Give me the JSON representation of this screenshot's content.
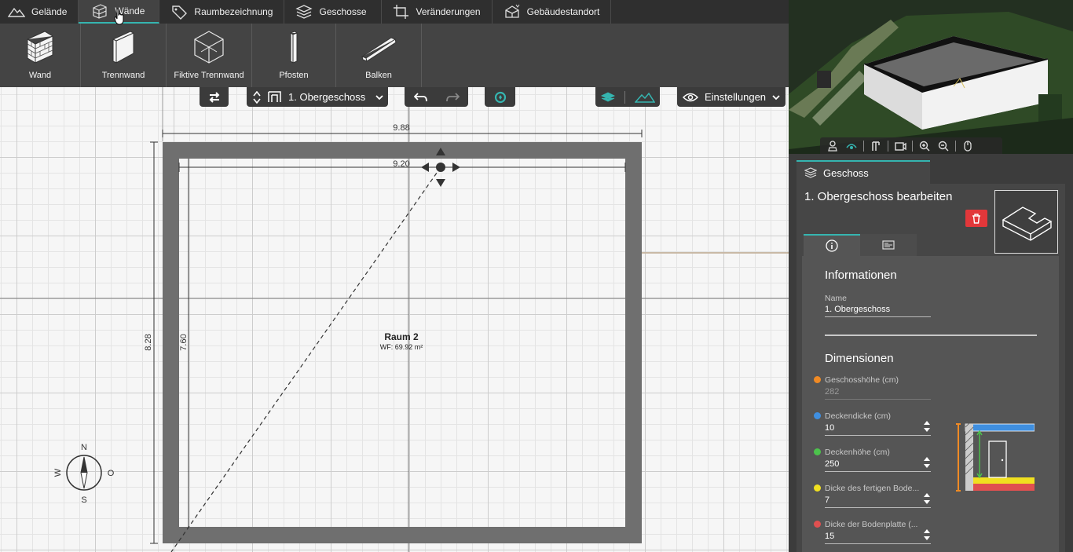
{
  "top_tabs": [
    {
      "label": "Gelände",
      "icon": "terrain-icon"
    },
    {
      "label": "Wände",
      "icon": "wall-icon"
    },
    {
      "label": "Raumbezeichnung",
      "icon": "tag-icon"
    },
    {
      "label": "Geschosse",
      "icon": "layers-icon"
    },
    {
      "label": "Veränderungen",
      "icon": "crop-icon"
    },
    {
      "label": "Gebäudestandort",
      "icon": "building-location-icon"
    }
  ],
  "ribbon": [
    {
      "label": "Wand",
      "icon": "brick-wall-icon"
    },
    {
      "label": "Trennwand",
      "icon": "partition-wall-icon"
    },
    {
      "label": "Fiktive Trennwand",
      "icon": "fictive-wall-icon"
    },
    {
      "label": "Pfosten",
      "icon": "post-icon"
    },
    {
      "label": "Balken",
      "icon": "beam-icon"
    }
  ],
  "toolbar": {
    "floor_select": "1. Obergeschoss",
    "settings_label": "Einstellungen"
  },
  "plan": {
    "outer_width": "9.88",
    "inner_width": "9.20",
    "outer_height": "8.28",
    "inner_height": "7.60",
    "room_name": "Raum 2",
    "room_area": "WF: 69.92 m²",
    "compass": {
      "n": "N",
      "s": "S",
      "w": "W",
      "o": "O"
    }
  },
  "panel": {
    "tab": "Geschoss",
    "title": "1. Obergeschoss bearbeiten",
    "info_heading": "Informationen",
    "name_label": "Name",
    "name_value": "1. Obergeschoss",
    "dim_heading": "Dimensionen",
    "fields": [
      {
        "label": "Geschosshöhe (cm)",
        "value": "282",
        "color": "#f08a24",
        "disabled": true
      },
      {
        "label": "Deckendicke (cm)",
        "value": "10",
        "color": "#3f8fe0",
        "disabled": false
      },
      {
        "label": "Deckenhöhe (cm)",
        "value": "250",
        "color": "#4cc34c",
        "disabled": false
      },
      {
        "label": "Dicke des fertigen Bode...",
        "value": "7",
        "color": "#f0e020",
        "disabled": false
      },
      {
        "label": "Dicke der Bodenplatte (...",
        "value": "15",
        "color": "#e05050",
        "disabled": false
      }
    ]
  }
}
